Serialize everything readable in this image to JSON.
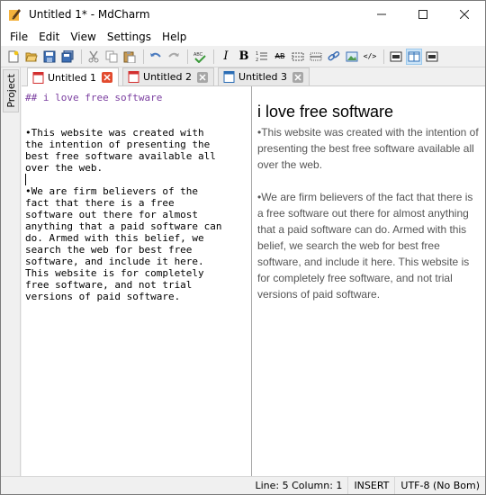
{
  "window": {
    "title": "Untitled 1* - MdCharm"
  },
  "menu": {
    "items": [
      "File",
      "Edit",
      "View",
      "Settings",
      "Help"
    ]
  },
  "toolbar": {
    "buttons": [
      "new-file",
      "open-folder",
      "save",
      "save-all",
      "cut",
      "copy",
      "paste",
      "undo",
      "redo",
      "spellcheck",
      "italic",
      "bold",
      "list",
      "strikethrough",
      "insert-table",
      "horizontal-rule",
      "link",
      "image",
      "code"
    ],
    "bold_label": "B",
    "italic_label": "I",
    "strike_label": "AB",
    "code_label": "</>"
  },
  "side_panel": {
    "tab_label": "Project"
  },
  "tabs": [
    {
      "label": "Untitled 1",
      "active": true
    },
    {
      "label": "Untitled 2",
      "active": false
    },
    {
      "label": "Untitled 3",
      "active": false
    }
  ],
  "editor": {
    "heading": "## i love free software",
    "lines_p1": [
      "•This website was created with",
      "the intention of presenting the",
      "best free software available all",
      "over the web."
    ],
    "lines_p2": [
      "•We are firm believers of the",
      "fact that there is a free",
      "software out there for almost",
      "anything that a paid software can",
      "do. Armed with this belief, we",
      "search the web for best free",
      "software, and include it here.",
      "This website is for completely",
      "free software, and not trial",
      "versions of paid software."
    ]
  },
  "preview": {
    "heading": "i love free software",
    "p1": "•This website was created with the intention of presenting the best free software available all over the web.",
    "p2": "•We are firm believers of the fact that there is a free software out there for almost anything that a paid software can do. Armed with this belief, we search the web for best free software, and include it here. This website is for completely free software, and not trial versions of paid software."
  },
  "status": {
    "position": "Line: 5 Column: 1",
    "mode": "INSERT",
    "encoding": "UTF-8 (No Bom)"
  },
  "colors": {
    "tab_close_active": "#e24b2f",
    "heading_markdown": "#7b3fa0",
    "preview_text": "#555555"
  }
}
